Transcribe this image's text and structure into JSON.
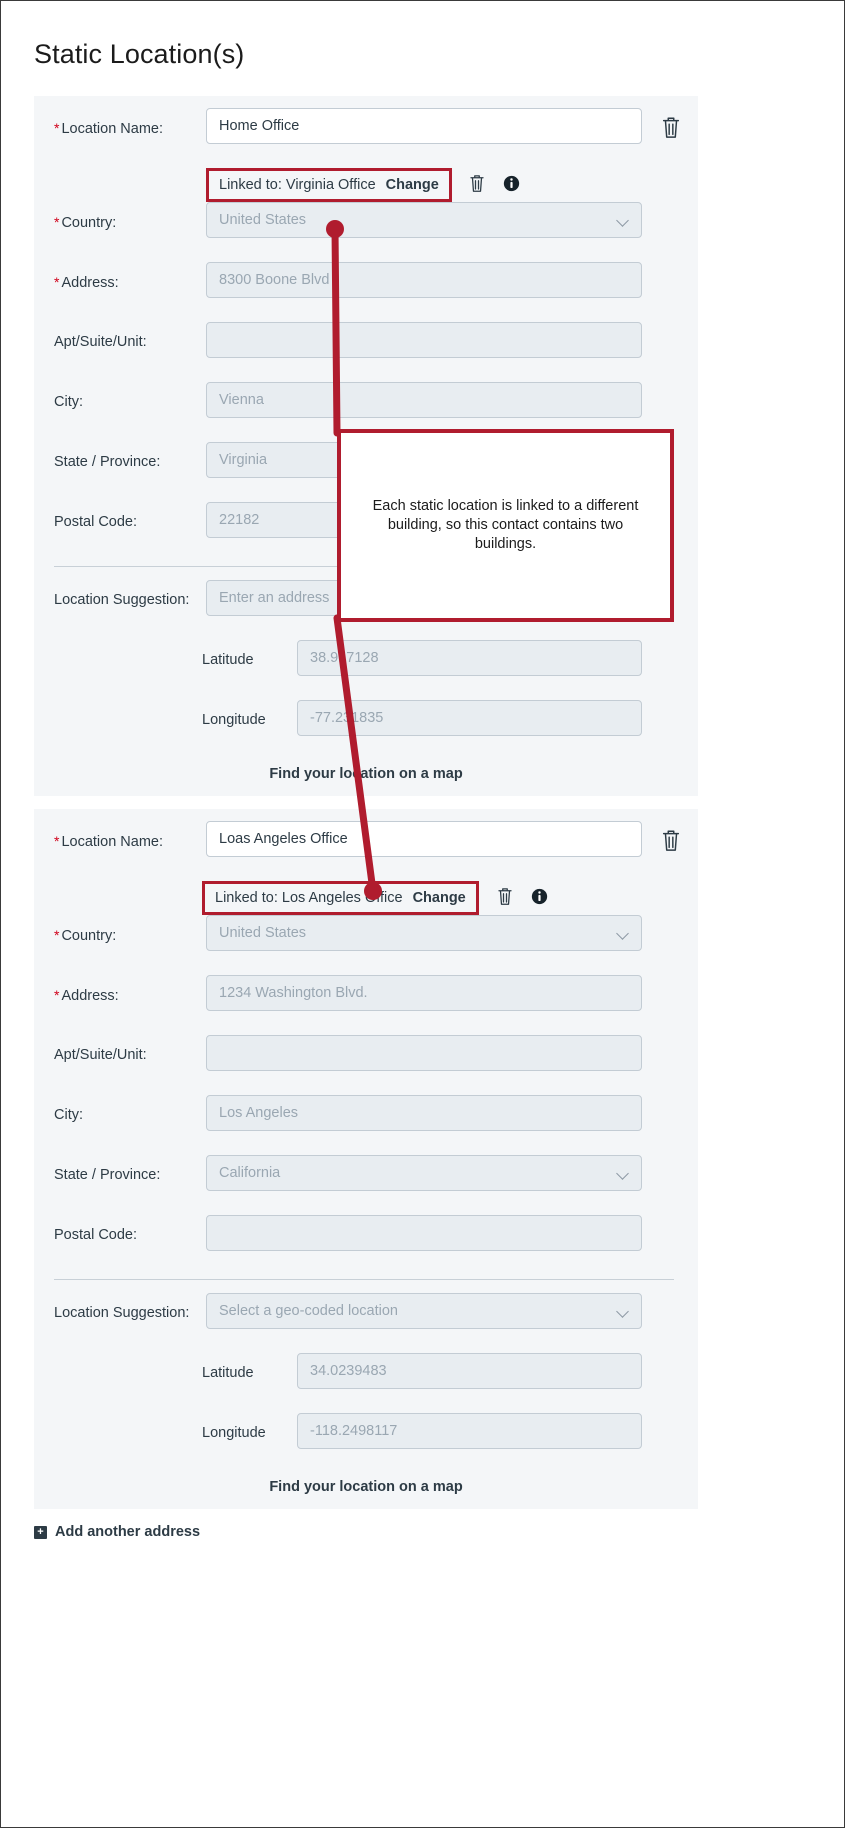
{
  "page": {
    "title": "Static Location(s)"
  },
  "labels": {
    "location_name": "Location Name",
    "country": "Country",
    "address": "Address",
    "apt_suite_unit": "Apt/Suite/Unit",
    "city": "City",
    "state_province": "State / Province",
    "postal_code": "Postal Code",
    "location_suggestion": "Location Suggestion",
    "latitude": "Latitude",
    "longitude": "Longitude",
    "colon": ":",
    "required_marker": "*"
  },
  "locations": [
    {
      "name_value": "Home Office",
      "linked_prefix": "Linked to: Virginia Office",
      "linked_change": "Change",
      "country": "United States",
      "address": "8300 Boone Blvd",
      "apt": "",
      "city": "Vienna",
      "state": "Virginia",
      "postal": "22182",
      "suggestion": "Enter an address",
      "latitude": "38.917128",
      "longitude": "-77.231835",
      "find_map": "Find your location on a map"
    },
    {
      "name_value": "Loas Angeles Office",
      "linked_prefix": "Linked to: Los Angeles Office",
      "linked_change": "Change",
      "country": "United States",
      "address": "1234 Washington Blvd.",
      "apt": "",
      "city": "Los Angeles",
      "state": "California",
      "postal": "",
      "suggestion": "Select a geo-coded location",
      "latitude": "34.0239483",
      "longitude": "-118.2498117",
      "find_map": "Find your location on a map"
    }
  ],
  "footer": {
    "add_another_label": "Add another address",
    "add_another_icon": "plus-square-icon"
  },
  "annotation": {
    "text": "Each static location is linked to a different building, so this contact contains two buildings.",
    "color": "#b01c2e"
  },
  "icons": {
    "trash": "trash-icon",
    "info": "info-circle-icon",
    "chevron": "chevron-down-icon"
  },
  "colors": {
    "accent_red": "#b01c2e",
    "required_red": "#d0021b",
    "card_bg": "#f4f6f8",
    "field_bg": "#e8edf1",
    "field_border": "#c3ccd4",
    "text": "#2d3b45",
    "placeholder": "#9aa7b2"
  }
}
